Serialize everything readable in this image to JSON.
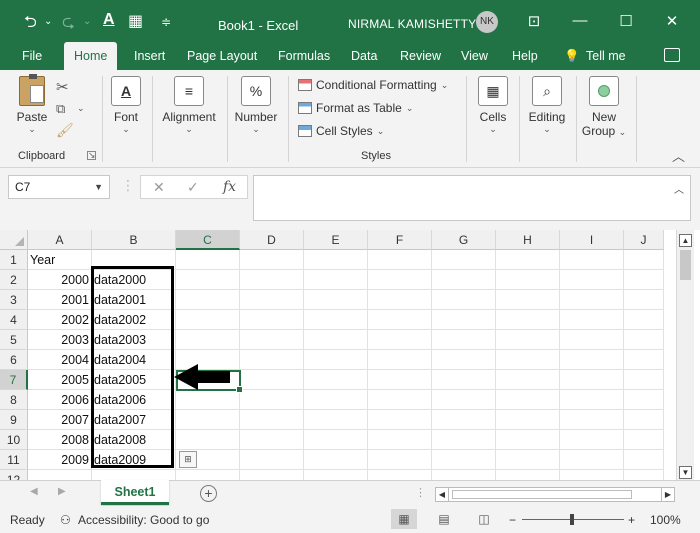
{
  "titlebar": {
    "title": "Book1 - Excel",
    "user": "NIRMAL KAMISHETTY",
    "avatar": "NK",
    "icons": [
      "save-icon",
      "undo-icon",
      "redo-icon",
      "font-color-icon",
      "table-icon",
      "customize-icon",
      "ribbon-display-icon",
      "minimize-icon",
      "maximize-icon",
      "close-icon"
    ]
  },
  "tabs": [
    "File",
    "Home",
    "Insert",
    "Page Layout",
    "Formulas",
    "Data",
    "Review",
    "View",
    "Help"
  ],
  "active_tab": "Home",
  "tell_me": "Tell me",
  "ribbon": {
    "paste": "Paste",
    "clipboard": "Clipboard",
    "font": "Font",
    "alignment": "Alignment",
    "number": "Number",
    "number_symbol": "%",
    "conditional_formatting": "Conditional Formatting",
    "format_as_table": "Format as Table",
    "cell_styles": "Cell Styles",
    "styles": "Styles",
    "cells": "Cells",
    "editing": "Editing",
    "new_group_1": "New",
    "new_group_2": "Group"
  },
  "formula_bar": {
    "name_box": "C7",
    "fx": "fx",
    "value": ""
  },
  "columns": [
    "A",
    "B",
    "C",
    "D",
    "E",
    "F",
    "G",
    "H",
    "I",
    "J"
  ],
  "selected_column": "C",
  "selected_row": "7",
  "rows": [
    {
      "num": "1",
      "a": "Year",
      "b": ""
    },
    {
      "num": "2",
      "a": "2000",
      "b": "data2000"
    },
    {
      "num": "3",
      "a": "2001",
      "b": "data2001"
    },
    {
      "num": "4",
      "a": "2002",
      "b": "data2002"
    },
    {
      "num": "5",
      "a": "2003",
      "b": "data2003"
    },
    {
      "num": "6",
      "a": "2004",
      "b": "data2004"
    },
    {
      "num": "7",
      "a": "2005",
      "b": "data2005"
    },
    {
      "num": "8",
      "a": "2006",
      "b": "data2006"
    },
    {
      "num": "9",
      "a": "2007",
      "b": "data2007"
    },
    {
      "num": "10",
      "a": "2008",
      "b": "data2008"
    },
    {
      "num": "11",
      "a": "2009",
      "b": "data2009"
    },
    {
      "num": "12",
      "a": "",
      "b": ""
    }
  ],
  "sheet_tab": "Sheet1",
  "status": {
    "ready": "Ready",
    "accessibility": "Accessibility: Good to go",
    "zoom": "100%",
    "zoom_level": 1.0
  },
  "colors": {
    "excel_green": "#217346",
    "highlight_border": "#000000",
    "arrow": "#000000"
  }
}
